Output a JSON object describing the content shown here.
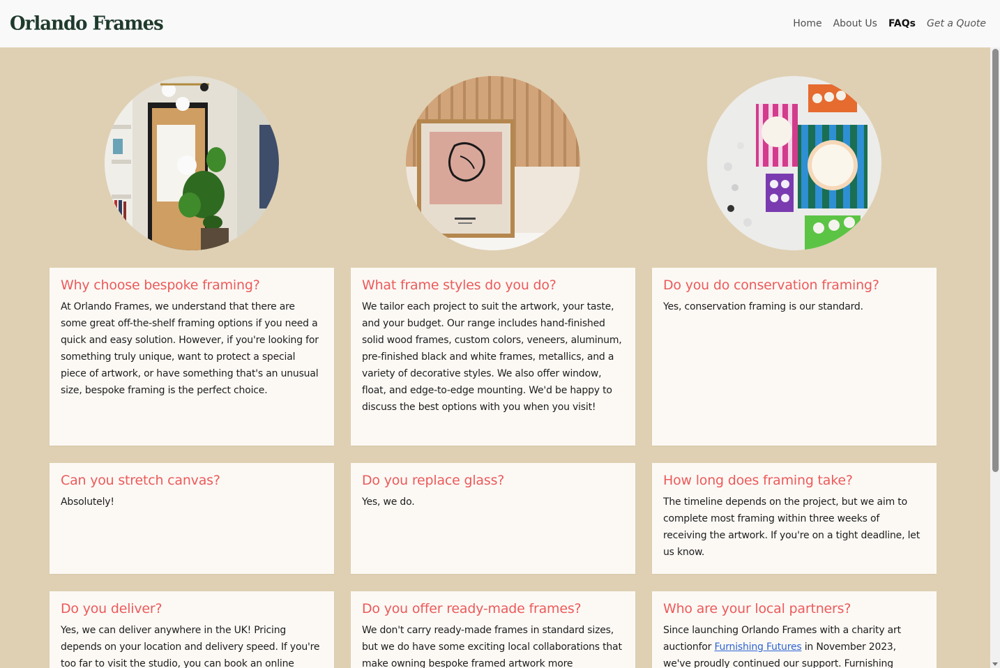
{
  "header": {
    "logo": "Orlando Frames",
    "nav": [
      "Home",
      "About Us",
      "FAQs",
      "Get a Quote"
    ]
  },
  "faqs": [
    {
      "q": "Why choose bespoke framing?",
      "a": "At Orlando Frames, we understand that there are some great off-the-shelf framing options if you need a quick and easy solution. However, if you're looking for something truly unique, want to protect a special piece of artwork, or have something that's an unusual size, bespoke framing is the perfect choice."
    },
    {
      "q": "What frame styles do you do?",
      "a": "We tailor each project to suit the artwork, your taste, and your budget. Our range includes hand-finished solid wood frames, custom colors, veneers, aluminum, pre-finished black and white frames, metallics, and a variety of decorative styles. We also offer window, float, and edge-to-edge mounting. We'd be happy to discuss the best options with you when you visit!"
    },
    {
      "q": "Do you do conservation framing?",
      "a": "Yes, conservation framing is our standard."
    },
    {
      "q": "Can you stretch canvas?",
      "a": "Absolutely!"
    },
    {
      "q": "Do you replace glass?",
      "a": "Yes, we do."
    },
    {
      "q": "How long does framing take?",
      "a": "The timeline depends on the project, but we aim to complete most framing within three weeks of receiving the artwork. If you're on a tight deadline, let us know."
    },
    {
      "q": "Do you deliver?",
      "a": "Yes, we can deliver anywhere in the UK! Pricing depends on your location and delivery speed. If you're too far to visit the studio, you can book an online"
    },
    {
      "q": "Do you offer ready-made frames?",
      "a": "We don't carry ready-made frames in standard sizes, but we do have some exciting local collaborations that make owning bespoke framed artwork more"
    },
    {
      "q": "Who are your local partners?",
      "a_before": "Since launching Orlando Frames with a charity art auctionfor ",
      "a_link": "Furnishing Futures",
      "a_after": " in November 2023, we've proudly continued our support. Furnishing"
    }
  ],
  "images": [
    {
      "name": "hallway-plant-photo"
    },
    {
      "name": "framed-artwork-photo"
    },
    {
      "name": "gallery-wall-photo"
    }
  ]
}
